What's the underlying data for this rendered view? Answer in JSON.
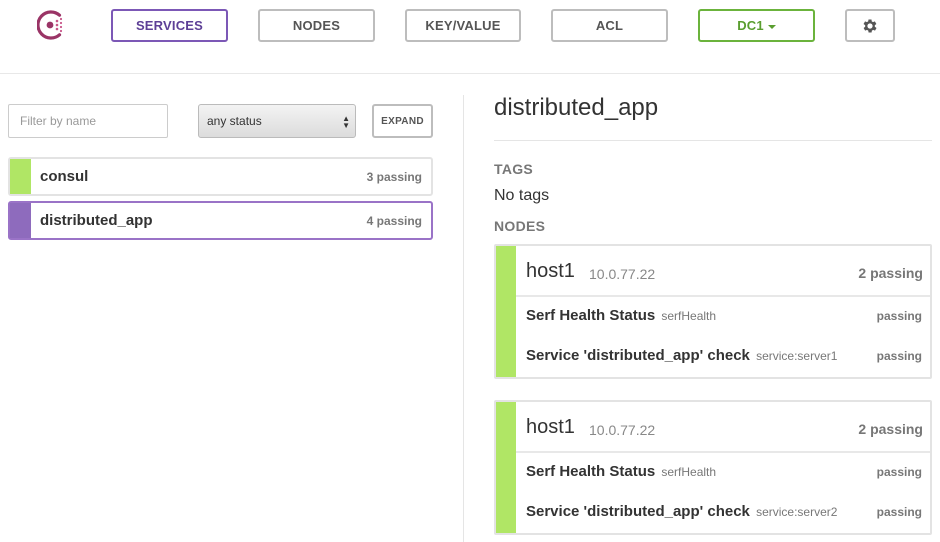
{
  "colors": {
    "passing": "#b0e665",
    "selected": "#8e6bbd",
    "accent_purple": "#7c58b6",
    "dc_green": "#6bb33c"
  },
  "nav": {
    "logo": "consul-logo-icon",
    "tabs": [
      "SERVICES",
      "NODES",
      "KEY/VALUE",
      "ACL"
    ],
    "active_tab": "SERVICES",
    "datacenter": "DC1",
    "settings_icon": "gear-icon"
  },
  "filter": {
    "placeholder": "Filter by name",
    "status_value": "any status",
    "expand_label": "EXPAND"
  },
  "services": [
    {
      "name": "consul",
      "status": "3 passing"
    },
    {
      "name": "distributed_app",
      "status": "4 passing"
    }
  ],
  "selected_service": "distributed_app",
  "detail": {
    "title": "distributed_app",
    "tags_label": "TAGS",
    "tags_value": "No tags",
    "nodes_label": "NODES",
    "nodes": [
      {
        "name": "host1",
        "ip": "10.0.77.22",
        "status": "2 passing",
        "checks": [
          {
            "name": "Serf Health Status",
            "id": "serfHealth",
            "status": "passing"
          },
          {
            "name": "Service 'distributed_app' check",
            "id": "service:server1",
            "status": "passing"
          }
        ]
      },
      {
        "name": "host1",
        "ip": "10.0.77.22",
        "status": "2 passing",
        "checks": [
          {
            "name": "Serf Health Status",
            "id": "serfHealth",
            "status": "passing"
          },
          {
            "name": "Service 'distributed_app' check",
            "id": "service:server2",
            "status": "passing"
          }
        ]
      }
    ]
  }
}
